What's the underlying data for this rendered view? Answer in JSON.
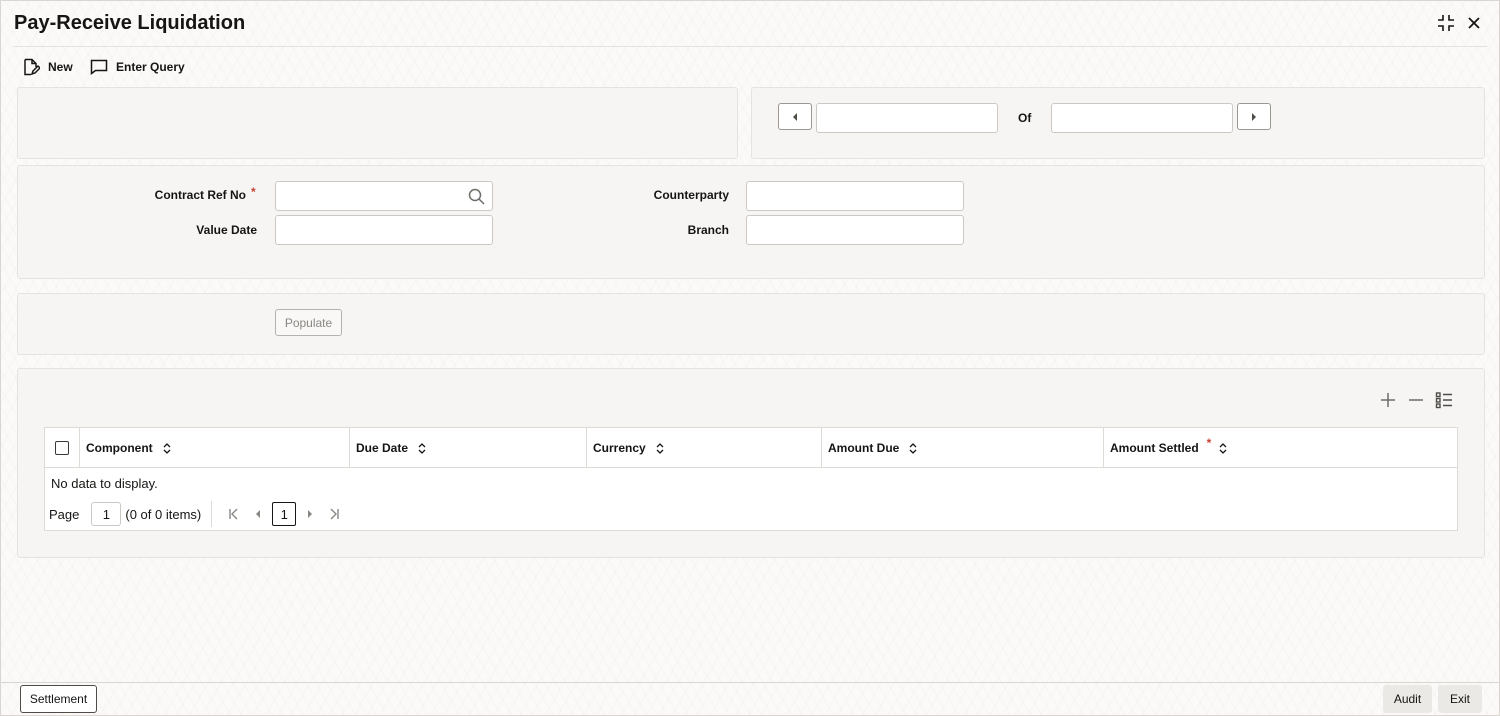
{
  "window": {
    "title": "Pay-Receive Liquidation",
    "minimize_icon": "compress-icon",
    "close_icon": "close-icon"
  },
  "toolbar": {
    "new_label": "New",
    "enter_query_label": "Enter Query"
  },
  "navigation": {
    "of_label": "Of",
    "current_value": "",
    "total_value": ""
  },
  "form": {
    "contract_ref_no_label": "Contract Ref No",
    "required_marker": "*",
    "value_date_label": "Value Date",
    "counterparty_label": "Counterparty",
    "branch_label": "Branch",
    "contract_ref_no_value": "",
    "value_date_value": "",
    "counterparty_value": "",
    "branch_value": ""
  },
  "populate_label": "Populate",
  "table": {
    "columns": [
      "Component",
      "Due Date",
      "Currency",
      "Amount Due",
      "Amount Settled"
    ],
    "amount_settled_required": "*",
    "empty_message": "No data to display.",
    "rows": []
  },
  "pager": {
    "page_label": "Page",
    "page_value": "1",
    "items_text": "(0 of 0 items)",
    "current_page": "1"
  },
  "footer": {
    "settlement_label": "Settlement",
    "audit_label": "Audit",
    "exit_label": "Exit"
  },
  "colors": {
    "required": "#c74634",
    "text": "#161513",
    "panel_bg": "#f6f5f4"
  }
}
